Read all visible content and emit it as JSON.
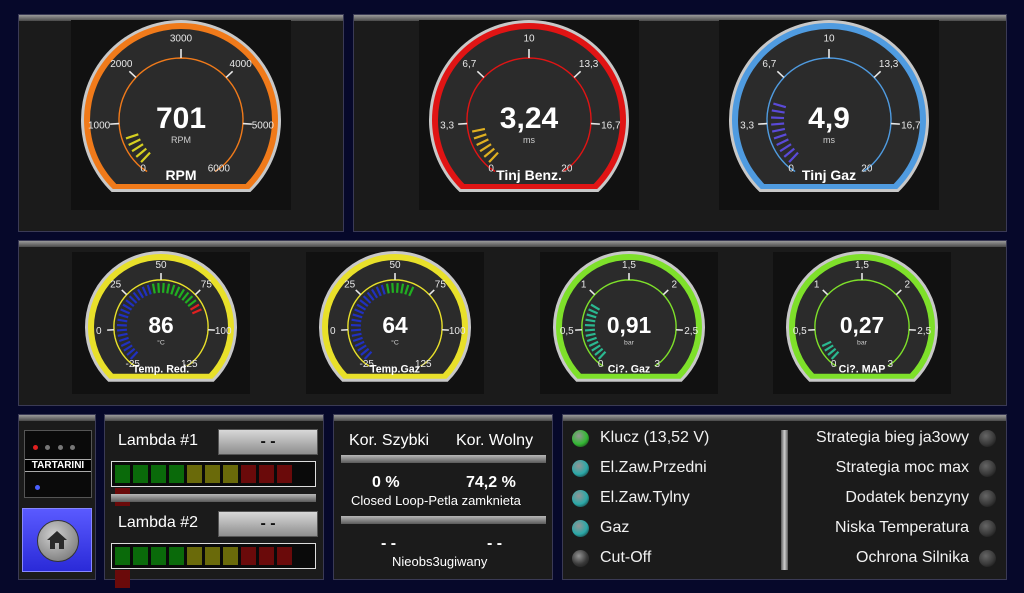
{
  "gauges_top": [
    {
      "id": "rpm",
      "value": "701",
      "unit": "RPM",
      "label": "RPM",
      "ticks": [
        "0",
        "1000",
        "2000",
        "3000",
        "4000",
        "5000",
        "6000"
      ],
      "color": "#f07a1a",
      "bar_color": "#d6d020",
      "level": 0.12
    },
    {
      "id": "tinj-benz",
      "value": "3,24",
      "unit": "ms",
      "label": "Tinj Benz.",
      "ticks": [
        "0",
        "3,3",
        "6,7",
        "10",
        "13,3",
        "16,7",
        "20"
      ],
      "color": "#e01414",
      "bar_color": "#e0b020",
      "level": 0.16
    },
    {
      "id": "tinj-gaz",
      "value": "4,9",
      "unit": "ms",
      "label": "Tinj Gaz",
      "ticks": [
        "0",
        "3,3",
        "6,7",
        "10",
        "13,3",
        "16,7",
        "20"
      ],
      "color": "#4f9be0",
      "bar_color": "#5a4ad8",
      "level": 0.25
    }
  ],
  "gauges_bottom": [
    {
      "id": "temp-red",
      "value": "86",
      "unit": "°C",
      "label": "Temp. Red.",
      "ticks": [
        "-25",
        "0",
        "25",
        "50",
        "75",
        "100",
        "125"
      ],
      "color": "#e8e02a",
      "bar_color": "#2030c0",
      "level": 0.74,
      "extra": "green-red"
    },
    {
      "id": "temp-gaz",
      "value": "64",
      "unit": "°C",
      "label": "Temp.Gaz",
      "ticks": [
        "-25",
        "0",
        "25",
        "50",
        "75",
        "100",
        "125"
      ],
      "color": "#e8e02a",
      "bar_color": "#2030c0",
      "level": 0.59,
      "extra": "green"
    },
    {
      "id": "cis-gaz",
      "value": "0,91",
      "unit": "bar",
      "label": "Ci?. Gaz",
      "ticks": [
        "0",
        "0,5",
        "1",
        "1,5",
        "2",
        "2,5",
        "3"
      ],
      "color": "#7ee02a",
      "bar_color": "#2ab890",
      "level": 0.3
    },
    {
      "id": "cis-map",
      "value": "0,27",
      "unit": "bar",
      "label": "Ci?. MAP",
      "ticks": [
        "0",
        "0,5",
        "1",
        "1,5",
        "2",
        "2,5",
        "3"
      ],
      "color": "#7ee02a",
      "bar_color": "#2ab890",
      "level": 0.09
    }
  ],
  "lambda": {
    "label1": "Lambda #1",
    "value1": "- -",
    "label2": "Lambda #2",
    "value2": "- -",
    "segment_colors": [
      "#0a6a0a",
      "#0a6a0a",
      "#0a6a0a",
      "#0a6a0a",
      "#6a6a0a",
      "#6a6a0a",
      "#6a6a0a",
      "#6a0a0a",
      "#6a0a0a",
      "#6a0a0a",
      "#6a0a0a"
    ]
  },
  "correction": {
    "short_label": "Kor. Szybki",
    "long_label": "Kor. Wolny",
    "short_value": "0 %",
    "long_value": "74,2 %",
    "status1": "Closed Loop-Petla zamknieta",
    "short_value2": "- -",
    "long_value2": "- -",
    "status2": "Nieobs3ugiwany"
  },
  "indicators_left": [
    {
      "label": "Klucz (13,52 V)",
      "color": "#33b833"
    },
    {
      "label": "El.Zaw.Przedni",
      "color": "#2aa8a8"
    },
    {
      "label": "El.Zaw.Tylny",
      "color": "#2aa8a8"
    },
    {
      "label": "Gaz",
      "color": "#2aa8a8"
    },
    {
      "label": "Cut-Off",
      "color": "#3a3a3a"
    }
  ],
  "indicators_right": [
    {
      "label": "Strategia bieg ja3owy",
      "color": "#3a3a3a"
    },
    {
      "label": "Strategia moc max",
      "color": "#3a3a3a"
    },
    {
      "label": "Dodatek benzyny",
      "color": "#3a3a3a"
    },
    {
      "label": "Niska Temperatura",
      "color": "#3a3a3a"
    },
    {
      "label": "Ochrona Silnika",
      "color": "#3a3a3a"
    }
  ],
  "logo": {
    "text": "TARTARINI"
  },
  "home_icon": "home-icon"
}
